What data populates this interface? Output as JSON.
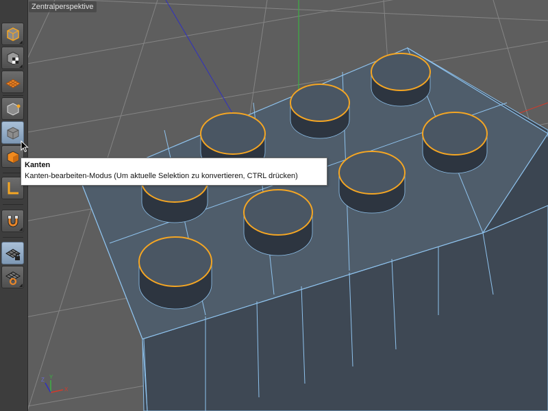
{
  "viewport": {
    "title": "Zentralperspektive"
  },
  "toolbar": {
    "items": [
      {
        "id": "model",
        "icon": "model-mode-icon",
        "active": false
      },
      {
        "id": "object",
        "icon": "object-mode-icon",
        "active": false
      },
      {
        "id": "texture",
        "icon": "texture-mode-icon",
        "active": false
      },
      {
        "id": "points",
        "icon": "points-mode-icon",
        "active": false
      },
      {
        "id": "edges",
        "icon": "edges-mode-icon",
        "active": true
      },
      {
        "id": "polygons",
        "icon": "polygons-mode-icon",
        "active": false
      },
      {
        "id": "axis",
        "icon": "axis-mode-icon",
        "active": false
      },
      {
        "id": "snap",
        "icon": "snap-magnet-icon",
        "active": false
      },
      {
        "id": "workplane-lock",
        "icon": "workplane-lock-icon",
        "active": true
      },
      {
        "id": "workplane",
        "icon": "workplane-icon",
        "active": false
      }
    ]
  },
  "tooltip": {
    "title": "Kanten",
    "description": "Kanten-bearbeiten-Modus (Um aktuelle Selektion zu konvertieren, CTRL drücken)"
  },
  "gizmo": {
    "z": "Z",
    "y": "Y",
    "x": "X"
  },
  "colors": {
    "background": "#5e5e5e",
    "grid": "#8a8a8a",
    "brick_top": "#4f5d6b",
    "brick_side": "#404b57",
    "edge": "#8fc3ee",
    "selection": "#f5a623",
    "axis_x": "#d43a2a",
    "axis_y": "#3cb043",
    "axis_z": "#3030c0",
    "active_tool": "#9ab4d0"
  }
}
